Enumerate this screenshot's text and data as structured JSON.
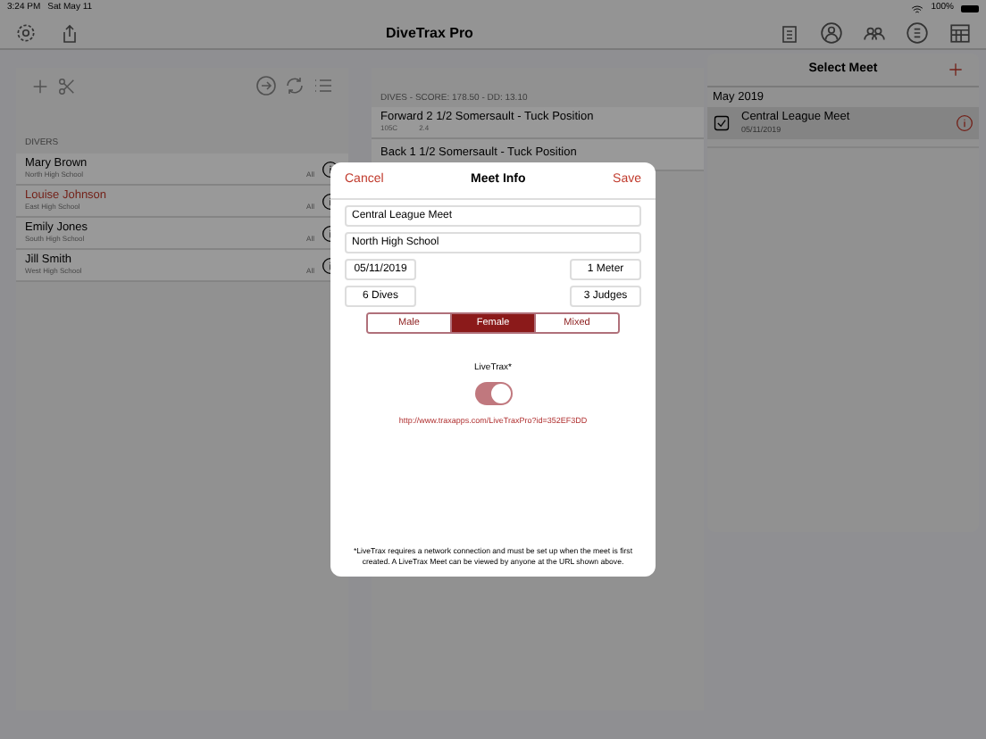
{
  "status_bar": {
    "time": "3:24 PM",
    "date": "Sat May 11",
    "battery": "100%"
  },
  "nav": {
    "title": "DiveTrax Pro"
  },
  "divers": {
    "header": "DIVERS",
    "rows": [
      {
        "name": "Mary Brown",
        "school": "North High School",
        "events": "All",
        "selected": false
      },
      {
        "name": "Louise Johnson",
        "school": "East High School",
        "events": "All",
        "selected": true
      },
      {
        "name": "Emily Jones",
        "school": "South High School",
        "events": "All",
        "selected": false
      },
      {
        "name": "Jill Smith",
        "school": "West High School",
        "events": "All",
        "selected": false
      }
    ]
  },
  "dives": {
    "header": "DIVES - SCORE:  178.50 - DD: 13.10",
    "rows": [
      {
        "name": "Forward 2 1/2 Somersault - Tuck Position",
        "code": "105C",
        "dd": "2.4"
      },
      {
        "name": "Back 1 1/2 Somersault - Tuck Position"
      }
    ]
  },
  "select_meet": {
    "title": "Select Meet",
    "sections": [
      {
        "heading": "May 2019",
        "meets": [
          {
            "name": "Central League Meet",
            "date": "05/11/2019",
            "selected": true
          }
        ]
      }
    ]
  },
  "meet_info": {
    "cancel": "Cancel",
    "title": "Meet Info",
    "save": "Save",
    "name": "Central League Meet",
    "host": "North High School",
    "date": "05/11/2019",
    "board": "1 Meter",
    "dives": "6 Dives",
    "judges": "3 Judges",
    "genders": [
      {
        "label": "Male",
        "selected": false
      },
      {
        "label": "Female",
        "selected": true
      },
      {
        "label": "Mixed",
        "selected": false
      }
    ],
    "livetrax_label": "LiveTrax*",
    "livetrax_on": true,
    "url": "http://www.traxapps.com/LiveTraxPro?id=352EF3DD",
    "note": "*LiveTrax requires a network connection and must be set up when the meet is first created.  A LiveTrax Meet can be viewed by anyone at the URL shown above."
  }
}
